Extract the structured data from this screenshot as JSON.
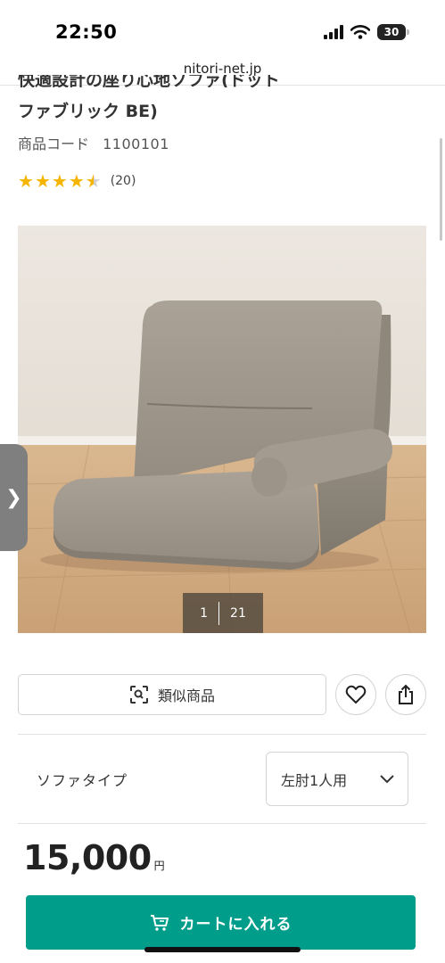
{
  "status_bar": {
    "time": "22:50",
    "battery": "30"
  },
  "browser": {
    "url": "nitori-net.jp"
  },
  "product": {
    "title_line2": "ファブリック BE)",
    "code_label": "商品コード",
    "code_value": "1100101",
    "rating": 4.5,
    "review_count": "(20)"
  },
  "gallery": {
    "current": "1",
    "total": "21"
  },
  "actions": {
    "similar_label": "類似商品"
  },
  "options": {
    "sofa_type_label": "ソファタイプ",
    "sofa_type_value": "左肘1人用"
  },
  "price": {
    "amount": "15,000",
    "currency": "円"
  },
  "cart": {
    "label": "カートに入れる"
  },
  "colors": {
    "accent": "#009e8a",
    "star": "#f5b400"
  }
}
